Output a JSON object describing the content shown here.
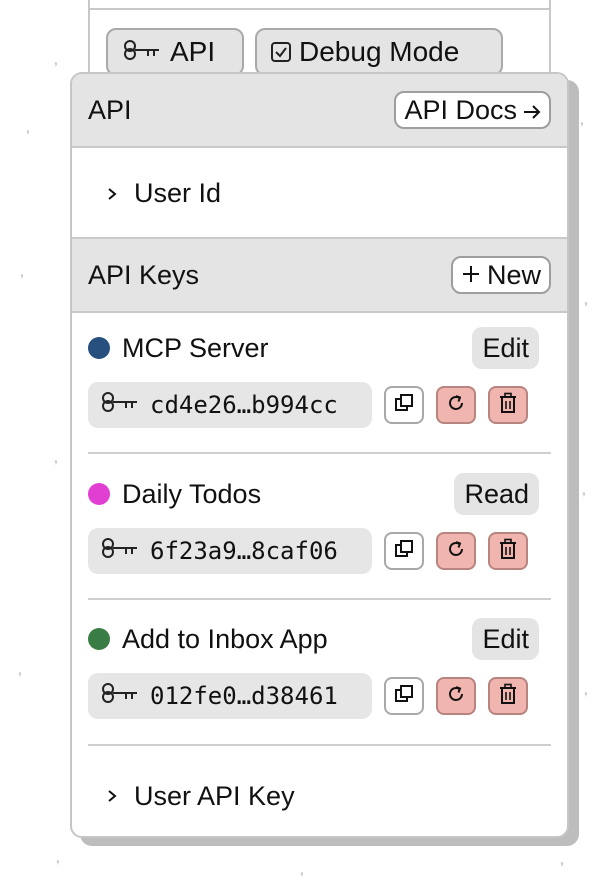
{
  "background": {
    "api_button_label": "API",
    "debug_button_label": "Debug Mode"
  },
  "popover": {
    "api_title": "API",
    "api_docs_label": "API Docs",
    "user_id_label": "User Id",
    "api_keys_title": "API Keys",
    "new_button_label": "New",
    "user_api_key_label": "User API Key",
    "keys": [
      {
        "name": "MCP Server",
        "color": "#27507f",
        "permission": "Edit",
        "key": "cd4e26…b994cc"
      },
      {
        "name": "Daily Todos",
        "color": "#e03fd1",
        "permission": "Read",
        "key": "6f23a9…8caf06"
      },
      {
        "name": "Add to Inbox App",
        "color": "#3a7d44",
        "permission": "Edit",
        "key": "012fe0…d38461"
      }
    ]
  },
  "colors": {
    "header_bg": "#e4e4e4",
    "danger_button": "#f0b5ae",
    "key_field_bg": "#e6e6e6"
  }
}
